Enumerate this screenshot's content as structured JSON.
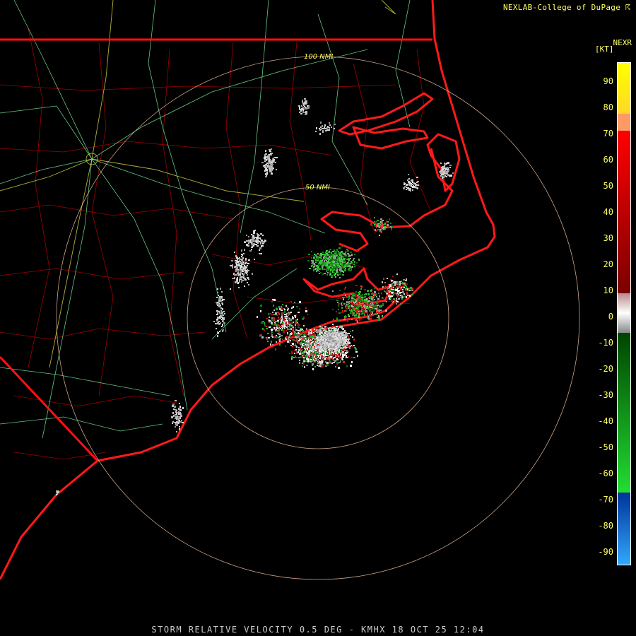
{
  "header": {
    "credit": "NEXLAB-College of DuPage ☈",
    "product": "NEXR",
    "units": "[KT]"
  },
  "rings": [
    "100 NMI",
    "50 NMI"
  ],
  "scale": {
    "ticks": [
      "90",
      "80",
      "70",
      "60",
      "50",
      "40",
      "30",
      "20",
      "10",
      "0",
      "-10",
      "-20",
      "-30",
      "-40",
      "-50",
      "-60",
      "-70",
      "-80",
      "-90"
    ]
  },
  "footer": "STORM RELATIVE VELOCITY 0.5 DEG - KMHX 18 OCT 25 12:04",
  "colors": {
    "state_lines": "#ff0000",
    "county_lines": "#b00000",
    "highways": "#88ffaa",
    "interstates": "#ffff66",
    "rings": "#ffccaa"
  }
}
